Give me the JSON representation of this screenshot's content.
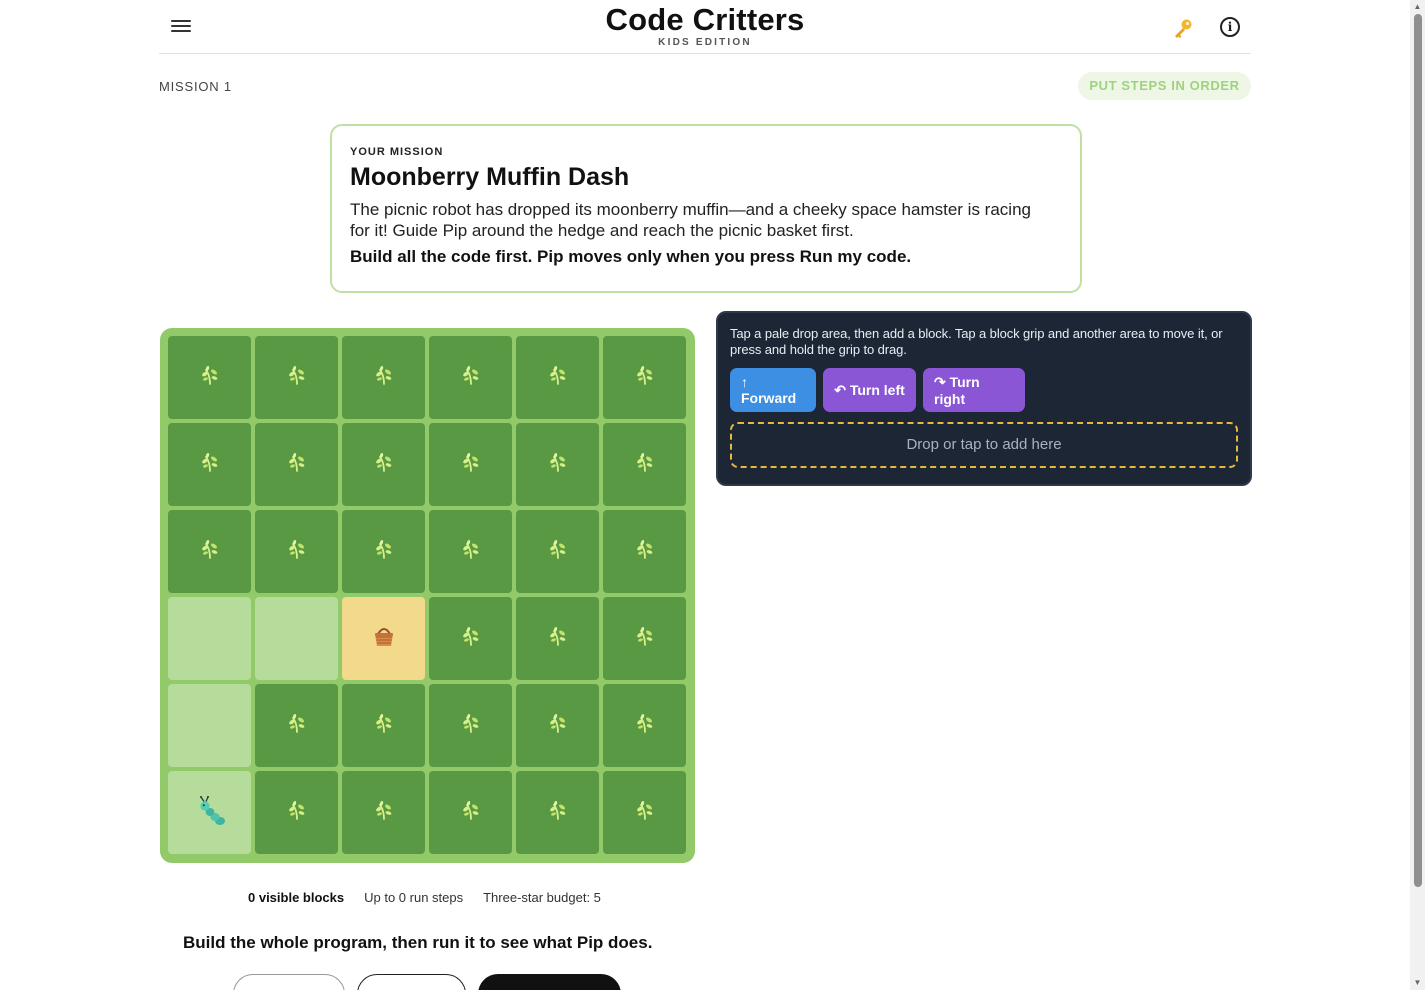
{
  "header": {
    "title": "Code Critters",
    "subtitle": "KIDS EDITION",
    "menu_icon": "hamburger-icon",
    "key_icon": "key-icon",
    "info_icon": "info-icon",
    "info_glyph": "i"
  },
  "mission_bar": {
    "label": "MISSION 1",
    "mode_badge": "PUT STEPS IN ORDER"
  },
  "mission_card": {
    "kicker": "YOUR MISSION",
    "title": "Moonberry Muffin Dash",
    "description": "The picnic robot has dropped its moonberry muffin—and a cheeky space hamster is racing for it! Guide Pip around the hedge and reach the picnic basket first.",
    "instruction": "Build all the code first. Pip moves only when you press Run my code."
  },
  "board": {
    "rows": 6,
    "cols": 6,
    "cells": [
      [
        "grass",
        "grass",
        "grass",
        "grass",
        "grass",
        "grass"
      ],
      [
        "grass",
        "grass",
        "grass",
        "grass",
        "grass",
        "grass"
      ],
      [
        "grass",
        "grass",
        "grass",
        "grass",
        "grass",
        "grass"
      ],
      [
        "path",
        "path",
        "goal",
        "grass",
        "grass",
        "grass"
      ],
      [
        "path",
        "grass",
        "grass",
        "grass",
        "grass",
        "grass"
      ],
      [
        "start",
        "grass",
        "grass",
        "grass",
        "grass",
        "grass"
      ]
    ],
    "grass_icon": "sprout-icon",
    "goal_icon": "basket-icon",
    "player_icon": "caterpillar-icon"
  },
  "code_panel": {
    "hint": "Tap a pale drop area, then add a block. Tap a block grip and another area to move it, or press and hold the grip to drag.",
    "blocks": {
      "forward": "↑ Forward",
      "turn_left": "↶ Turn left",
      "turn_right": "↷ Turn right"
    },
    "drop_zone": "Drop or tap to add here"
  },
  "stats": {
    "visible_blocks": "0 visible blocks",
    "run_steps": "Up to 0 run steps",
    "budget": "Three-star budget: 5"
  },
  "run_instruction": "Build the whole program, then run it to see what Pip does.",
  "colors": {
    "grass": "#5a9944",
    "path": "#b5dc9b",
    "goal": "#f2d98b",
    "board_frame": "#92c969",
    "panel_bg": "#1d2634",
    "forward_block": "#3d8fe3",
    "turn_block": "#8a56d6",
    "drop_border": "#e6b93b"
  }
}
